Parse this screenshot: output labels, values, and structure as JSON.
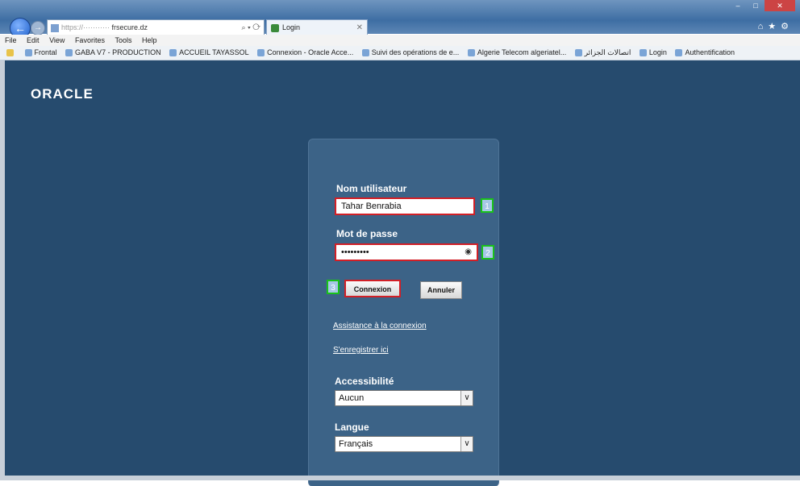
{
  "browser": {
    "address_host": "frsecure.dz",
    "tab_title": "Login",
    "menu": [
      "File",
      "Edit",
      "View",
      "Favorites",
      "Tools",
      "Help"
    ],
    "favorites": [
      "Frontal",
      "GABA V7 - PRODUCTION",
      "ACCUEIL TAYASSOL",
      "Connexion - Oracle Acce...",
      "Suivi des opérations de e...",
      "Algerie Telecom algeriatel...",
      "اتصالات الجزائر",
      "Login",
      "Authentification"
    ]
  },
  "page": {
    "logo": "ORACLE",
    "form": {
      "username_label": "Nom utilisateur",
      "username_value": "Tahar Benrabia",
      "password_label": "Mot de passe",
      "password_value": "•••••••••",
      "login_button": "Connexion",
      "cancel_button": "Annuler",
      "assist_link": "Assistance à la connexion",
      "register_link": "S'enregistrer ici",
      "accessibility_label": "Accessibilité",
      "accessibility_value": "Aucun",
      "language_label": "Langue",
      "language_value": "Français"
    },
    "callouts": [
      "1",
      "2",
      "3"
    ]
  },
  "colors": {
    "page_bg": "#264b6e",
    "panel_bg": "#3c6387",
    "highlight_red": "#d21f26",
    "highlight_green": "#19c21a"
  }
}
